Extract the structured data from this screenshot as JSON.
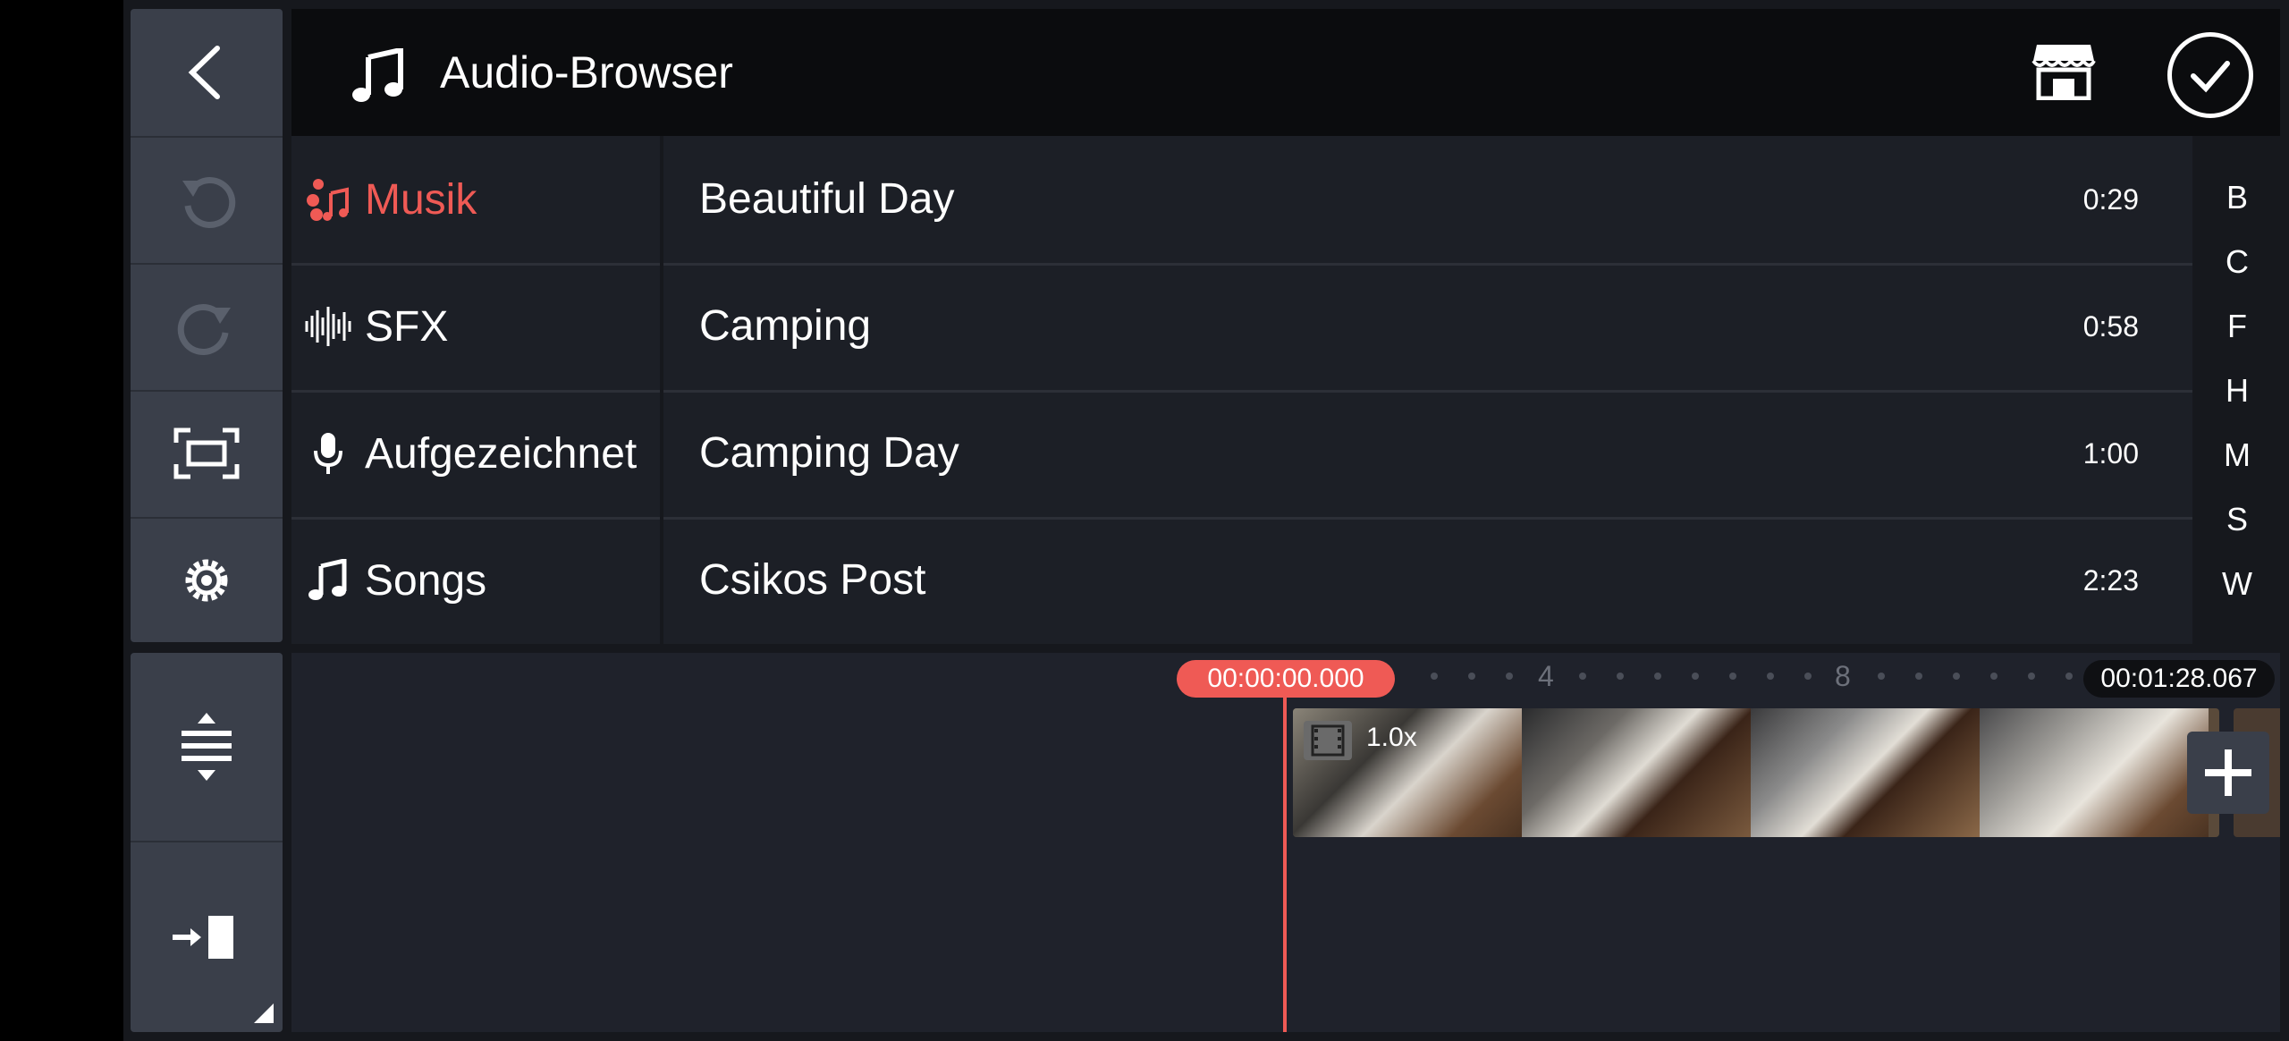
{
  "header": {
    "title": "Audio-Browser"
  },
  "categories": [
    {
      "label": "Musik",
      "icon": "music-dots-icon",
      "active": true
    },
    {
      "label": "SFX",
      "icon": "waveform-icon",
      "active": false
    },
    {
      "label": "Aufgezeichnet",
      "icon": "microphone-icon",
      "active": false
    },
    {
      "label": "Songs",
      "icon": "music-note-icon",
      "active": false
    }
  ],
  "tracks": [
    {
      "name": "Beautiful Day",
      "duration": "0:29"
    },
    {
      "name": "Camping",
      "duration": "0:58"
    },
    {
      "name": "Camping Day",
      "duration": "1:00"
    },
    {
      "name": "Csikos Post",
      "duration": "2:23"
    }
  ],
  "alpha_index": [
    "B",
    "C",
    "F",
    "H",
    "M",
    "S",
    "W"
  ],
  "timeline": {
    "current_time": "00:00:00.000",
    "total_time": "00:01:28.067",
    "ruler_labels": [
      "4",
      "8"
    ],
    "clip_speed": "1.0x"
  },
  "colors": {
    "accent": "#ef5a55",
    "panel": "#3a3f4a",
    "background": "#16181d"
  }
}
